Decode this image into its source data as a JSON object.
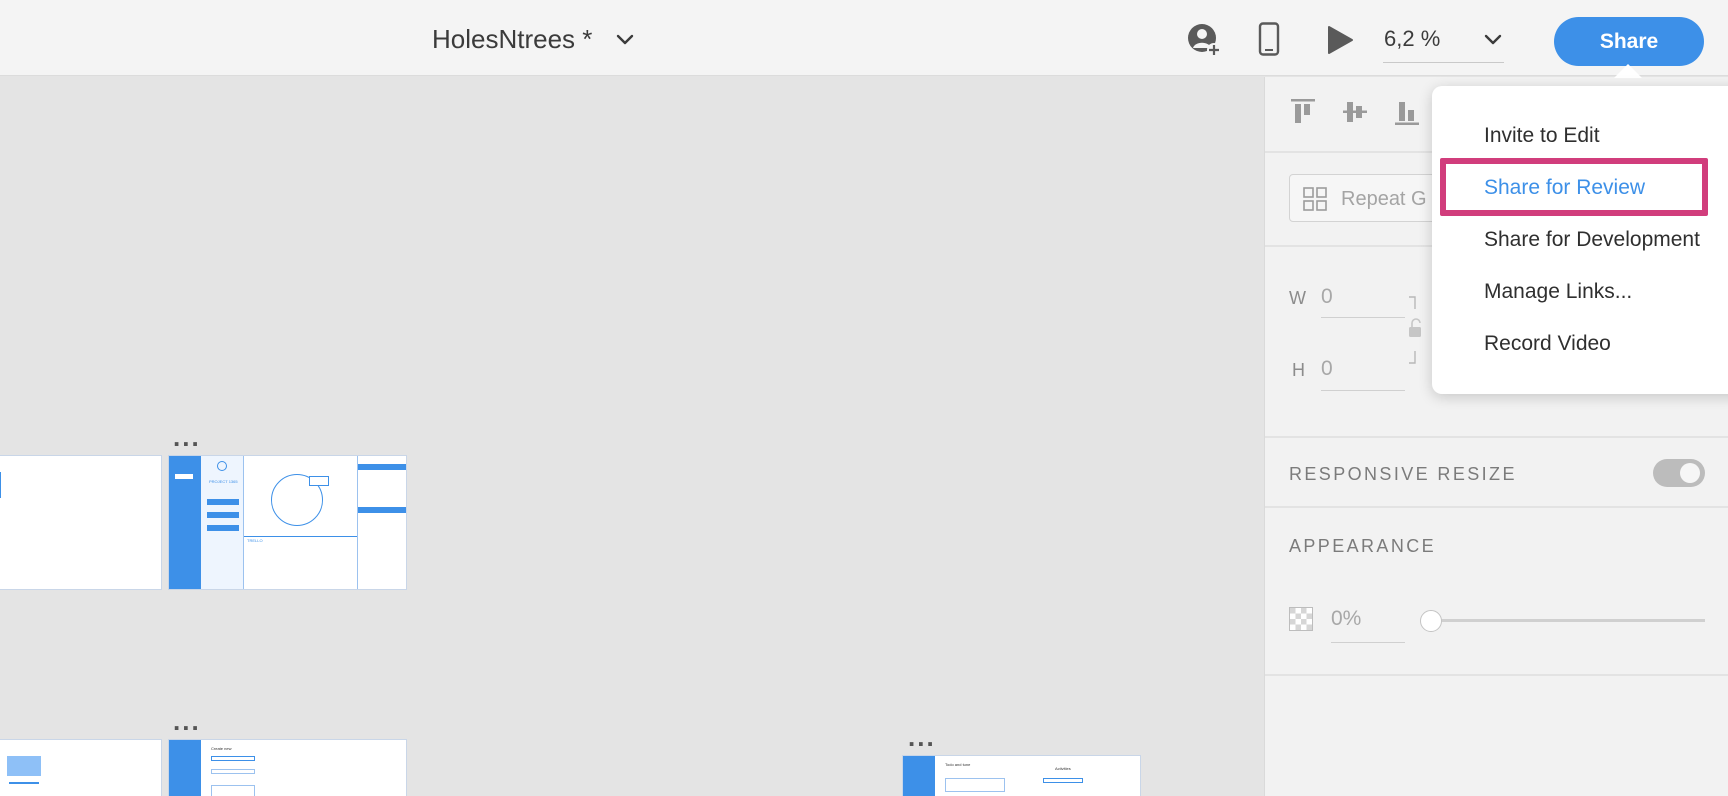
{
  "header": {
    "document_title": "HolesNtrees *",
    "zoom": "6,2 %",
    "share_label": "Share",
    "icons": {
      "title_dropdown": "chevron-down-icon",
      "invite": "user-add-icon",
      "device_preview": "mobile-device-icon",
      "play": "play-icon",
      "zoom_dropdown": "chevron-down-icon"
    }
  },
  "share_menu": {
    "items": [
      {
        "label": "Invite to Edit",
        "highlighted": false
      },
      {
        "label": "Share for Review",
        "highlighted": true
      },
      {
        "label": "Share for Development",
        "highlighted": false
      },
      {
        "label": "Manage Links...",
        "highlighted": false
      },
      {
        "label": "Record Video",
        "highlighted": false
      }
    ],
    "highlight_color": "#d13d7c"
  },
  "properties_panel": {
    "align_icons": [
      "align-top-icon",
      "align-middle-icon",
      "align-bottom-icon"
    ],
    "repeat_grid_label": "Repeat G",
    "width": {
      "label": "W",
      "value": "0"
    },
    "height": {
      "label": "H",
      "value": "0"
    },
    "lock_icon": "lock-open-icon",
    "responsive_resize": {
      "label": "RESPONSIVE RESIZE",
      "enabled": false
    },
    "appearance": {
      "label": "APPEARANCE",
      "opacity": "0%"
    }
  },
  "canvas": {
    "artboard_mini_text": {
      "project_title": "PROJECT 1365",
      "trello": "TRELLO",
      "create_new": "Create new",
      "todo_title": "Todo and tune",
      "subtitle": "Activities"
    },
    "more_icon": "more-horizontal-icon"
  },
  "colors": {
    "accent": "#3d90e8",
    "panel_bg": "#f2f2f2",
    "canvas_bg": "#e4e4e4"
  }
}
